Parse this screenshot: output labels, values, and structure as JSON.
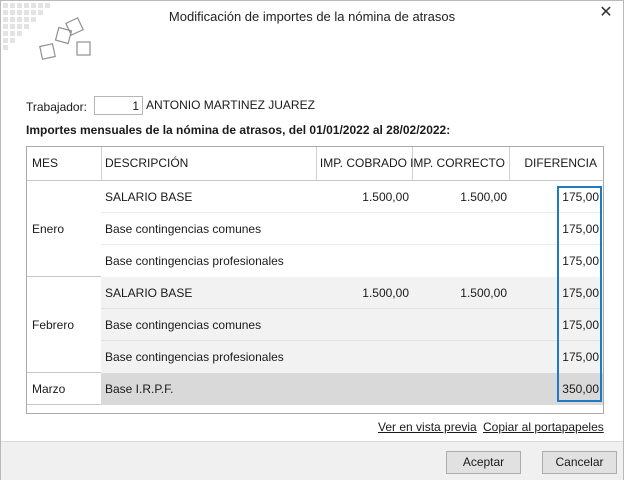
{
  "window": {
    "title": "Modificación de importes de la nómina de atrasos",
    "close_glyph": "✕"
  },
  "worker": {
    "label": "Trabajador:",
    "code": "1",
    "name": "ANTONIO MARTINEZ JUAREZ"
  },
  "section_title": "Importes mensuales de la nómina de atrasos, del 01/01/2022 al 28/02/2022:",
  "table": {
    "headers": {
      "mes": "MES",
      "descripcion": "DESCRIPCIÓN",
      "imp_cobrado": "IMP. COBRADO",
      "imp_correcto": "IMP. CORRECTO",
      "diferencia": "DIFERENCIA"
    },
    "months": [
      "Enero",
      "Febrero",
      "Marzo"
    ],
    "rows": [
      {
        "descripcion": "SALARIO BASE",
        "imp_cobrado": "1.500,00",
        "imp_correcto": "1.500,00",
        "diferencia": "175,00"
      },
      {
        "descripcion": "Base contingencias comunes",
        "imp_cobrado": "",
        "imp_correcto": "",
        "diferencia": "175,00"
      },
      {
        "descripcion": "Base contingencias profesionales",
        "imp_cobrado": "",
        "imp_correcto": "",
        "diferencia": "175,00"
      },
      {
        "descripcion": "SALARIO BASE",
        "imp_cobrado": "1.500,00",
        "imp_correcto": "1.500,00",
        "diferencia": "175,00"
      },
      {
        "descripcion": "Base contingencias comunes",
        "imp_cobrado": "",
        "imp_correcto": "",
        "diferencia": "175,00"
      },
      {
        "descripcion": "Base contingencias profesionales",
        "imp_cobrado": "",
        "imp_correcto": "",
        "diferencia": "175,00"
      },
      {
        "descripcion": "Base I.R.P.F.",
        "imp_cobrado": "",
        "imp_correcto": "",
        "diferencia": "350,00"
      }
    ]
  },
  "links": {
    "preview": "Ver en vista previa",
    "clipboard": "Copiar al portapapeles"
  },
  "buttons": {
    "accept": "Aceptar",
    "cancel": "Cancelar"
  },
  "colors": {
    "highlight_border": "#1f7bc1",
    "alt_row": "#f2f2f2",
    "selected_row": "#d9d9d9"
  }
}
